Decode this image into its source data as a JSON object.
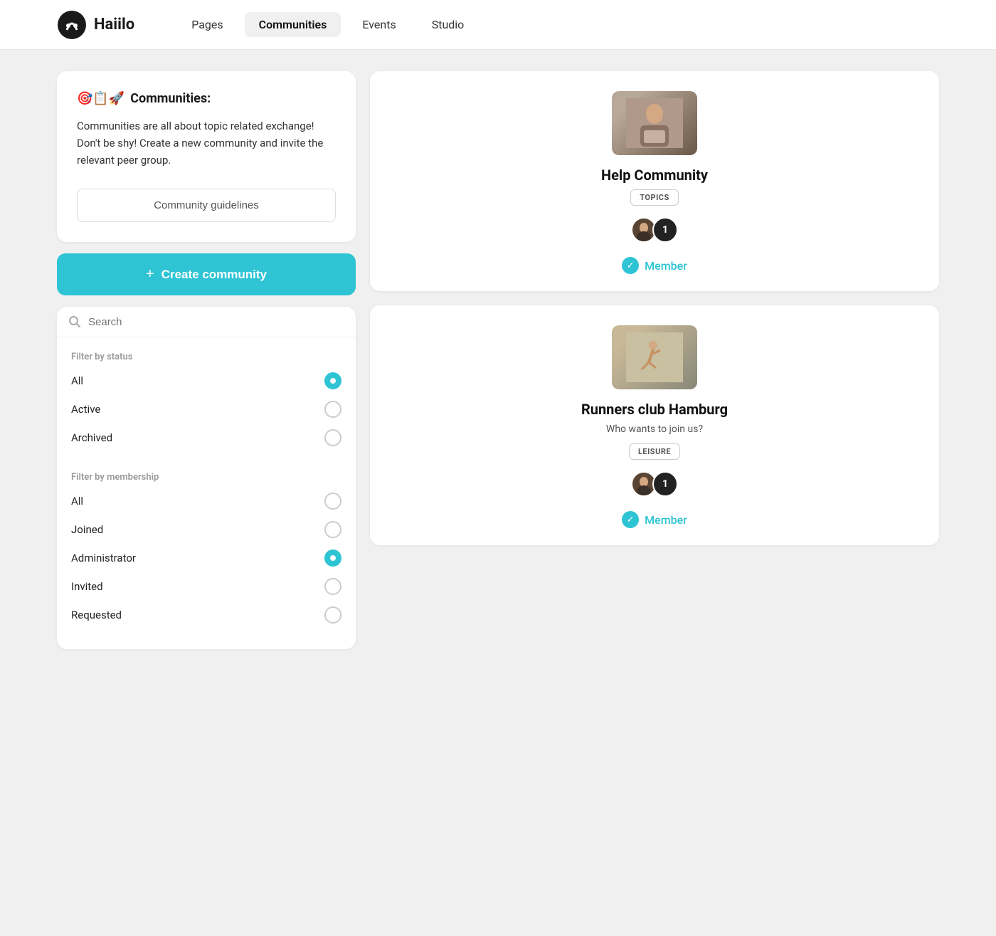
{
  "header": {
    "logo_text": "Haiilo",
    "nav_items": [
      {
        "id": "pages",
        "label": "Pages",
        "active": false
      },
      {
        "id": "communities",
        "label": "Communities",
        "active": true
      },
      {
        "id": "events",
        "label": "Events",
        "active": false
      },
      {
        "id": "studio",
        "label": "Studio",
        "active": false
      }
    ]
  },
  "info_card": {
    "header_icons": "🎯📋🚀",
    "header_label": "Communities:",
    "body_text": "Communities are all about topic related exchange! Don't be shy! Create a new community and invite the relevant peer group.",
    "guidelines_btn_label": "Community guidelines"
  },
  "create_btn": {
    "plus_icon": "+",
    "label": "Create community"
  },
  "search": {
    "placeholder": "Search"
  },
  "filter_status": {
    "label": "Filter by status",
    "options": [
      {
        "id": "all",
        "label": "All",
        "selected": true
      },
      {
        "id": "active",
        "label": "Active",
        "selected": false
      },
      {
        "id": "archived",
        "label": "Archived",
        "selected": false
      }
    ]
  },
  "filter_membership": {
    "label": "Filter by membership",
    "options": [
      {
        "id": "all",
        "label": "All",
        "selected": false
      },
      {
        "id": "joined",
        "label": "Joined",
        "selected": false
      },
      {
        "id": "administrator",
        "label": "Administrator",
        "selected": true
      },
      {
        "id": "invited",
        "label": "Invited",
        "selected": false
      },
      {
        "id": "requested",
        "label": "Requested",
        "selected": false
      }
    ]
  },
  "communities": [
    {
      "id": "help",
      "name": "Help Community",
      "subtitle": null,
      "tag": "TOPICS",
      "member_count": 1,
      "member_status": "Member"
    },
    {
      "id": "runners",
      "name": "Runners club Hamburg",
      "subtitle": "Who wants to join us?",
      "tag": "LEISURE",
      "member_count": 1,
      "member_status": "Member"
    }
  ]
}
